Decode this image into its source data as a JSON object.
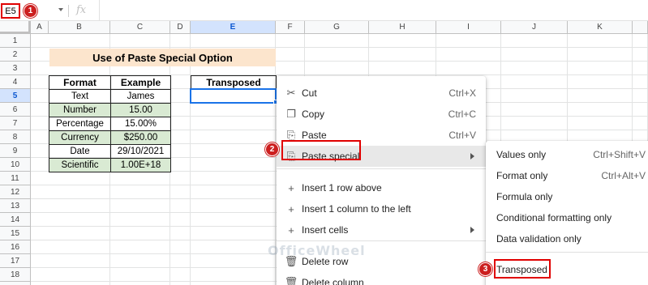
{
  "formula_bar": {
    "name_box": "E5",
    "fx_label": "fx"
  },
  "columns": [
    "A",
    "B",
    "C",
    "D",
    "E",
    "F",
    "G",
    "H",
    "I",
    "J",
    "K"
  ],
  "rows": [
    "1",
    "2",
    "3",
    "4",
    "5",
    "6",
    "7",
    "8",
    "9",
    "10",
    "11",
    "12",
    "13",
    "14",
    "15",
    "16",
    "17",
    "18",
    "19"
  ],
  "selected_cell": "E5",
  "sheet": {
    "title": "Use of Paste Special Option",
    "table_headers": [
      "Format",
      "Example"
    ],
    "table_rows": [
      {
        "format": "Text",
        "example": "James"
      },
      {
        "format": "Number",
        "example": "15.00"
      },
      {
        "format": "Percentage",
        "example": "15.00%"
      },
      {
        "format": "Currency",
        "example": "$250.00"
      },
      {
        "format": "Date",
        "example": "29/10/2021"
      },
      {
        "format": "Scientific",
        "example": "1.00E+18"
      }
    ],
    "transposed_header": "Transposed"
  },
  "context_menu": {
    "items": [
      {
        "icon": "scissors-icon",
        "label": "Cut",
        "shortcut": "Ctrl+X"
      },
      {
        "icon": "copy-icon",
        "label": "Copy",
        "shortcut": "Ctrl+C"
      },
      {
        "icon": "clipboard-icon",
        "label": "Paste",
        "shortcut": "Ctrl+V"
      },
      {
        "icon": "clipboard-icon",
        "label": "Paste special",
        "submenu": true
      },
      {
        "icon": "plus-icon",
        "label": "Insert 1 row above"
      },
      {
        "icon": "plus-icon",
        "label": "Insert 1 column to the left"
      },
      {
        "icon": "plus-icon",
        "label": "Insert cells",
        "submenu": true
      },
      {
        "icon": "trash-icon",
        "label": "Delete row"
      },
      {
        "icon": "trash-icon",
        "label": "Delete column"
      }
    ]
  },
  "submenu": {
    "items": [
      {
        "label": "Values only",
        "shortcut": "Ctrl+Shift+V"
      },
      {
        "label": "Format only",
        "shortcut": "Ctrl+Alt+V"
      },
      {
        "label": "Formula only"
      },
      {
        "label": "Conditional formatting only"
      },
      {
        "label": "Data validation only"
      },
      {
        "label": "Transposed"
      }
    ]
  },
  "step_markers": [
    "1",
    "2",
    "3"
  ],
  "watermark": "OfficeWheel",
  "colors": {
    "accent": "#1a73e8",
    "highlight_red": "#e00000",
    "title_fill": "#fce5cd",
    "green_fill": "#d9ead3"
  }
}
